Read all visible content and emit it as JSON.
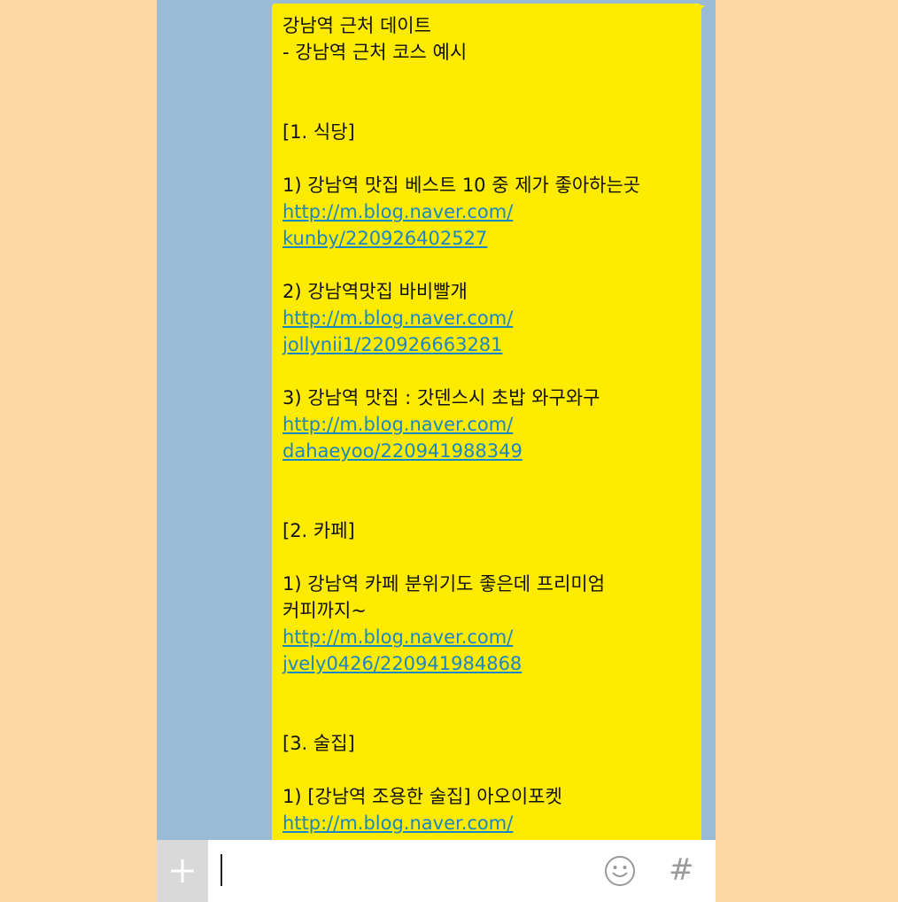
{
  "message": {
    "title1": "강남역 근처 데이트",
    "title2": "- 강남역 근처 코스 예시",
    "section1": "[1. 식당]",
    "s1_item1": "1) 강남역 맛집 베스트 10 중 제가 좋아하는곳",
    "s1_item1_link_a": "http://m.blog.naver.com/",
    "s1_item1_link_b": "kunby/220926402527",
    "s1_item2": "2) 강남역맛집 바비빨개",
    "s1_item2_link_a": "http://m.blog.naver.com/",
    "s1_item2_link_b": "jollynii1/220926663281",
    "s1_item3": "3) 강남역 맛집 : 갓덴스시 초밥 와구와구",
    "s1_item3_link_a": "http://m.blog.naver.com/",
    "s1_item3_link_b": "dahaeyoo/220941988349",
    "section2": "[2. 카페]",
    "s2_item1_a": "1) 강남역 카페 분위기도 좋은데 프리미엄",
    "s2_item1_b": "커피까지~",
    "s2_item1_link_a": "http://m.blog.naver.com/",
    "s2_item1_link_b": "jvely0426/220941984868",
    "section3": "[3. 술집]",
    "s3_item1": "1) [강남역 조용한 술집] 아오이포켓",
    "s3_item1_link_a": "http://m.blog.naver.com/"
  },
  "input_bar": {
    "plus_icon": "plus-icon",
    "emoji_icon": "smiley-icon",
    "hash_label": "#"
  },
  "colors": {
    "background": "#fed8a4",
    "chat_bg": "#9bbbd4",
    "bubble": "#ffeb00",
    "link": "#1b86c6"
  }
}
